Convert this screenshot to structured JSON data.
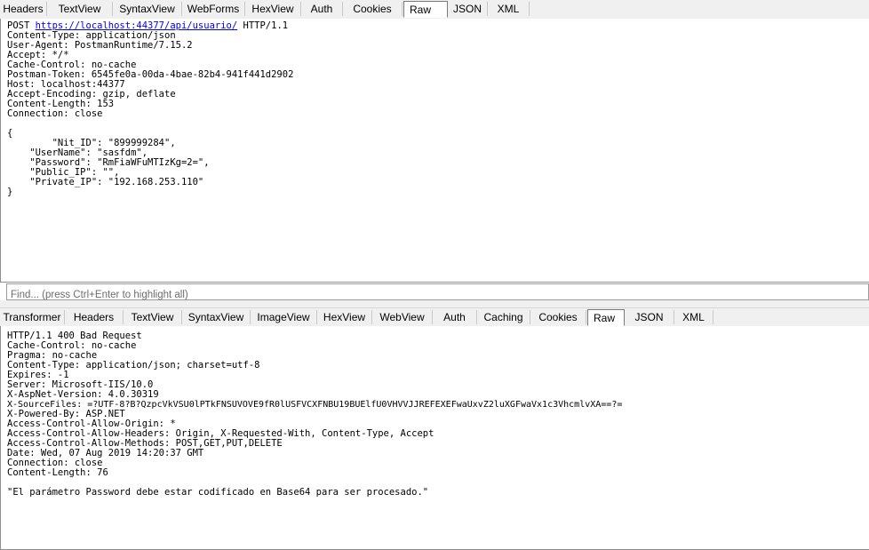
{
  "request_tabs": [
    "Headers",
    "TextView",
    "SyntaxView",
    "WebForms",
    "HexView",
    "Auth",
    "Cookies",
    "Raw",
    "JSON",
    "XML"
  ],
  "request_active_tab": "Raw",
  "request": {
    "method": "POST ",
    "url": "https://localhost:44377/api/usuario/",
    "protocol": " HTTP/1.1",
    "lines": [
      "Content-Type: application/json",
      "User-Agent: PostmanRuntime/7.15.2",
      "Accept: */*",
      "Cache-Control: no-cache",
      "Postman-Token: 6545fe0a-00da-4bae-82b4-941f441d2902",
      "Host: localhost:44377",
      "Accept-Encoding: gzip, deflate",
      "Content-Length: 153",
      "Connection: close",
      "",
      "{",
      "\t\"Nit_ID\": \"899999284\",",
      "    \"UserName\": \"sasfdm\",",
      "    \"Password\": \"RmFiaWFuMTIzKg=2=\",",
      "    \"Public_IP\": \"\",",
      "    \"Private_IP\": \"192.168.253.110\"",
      "}"
    ]
  },
  "find": {
    "placeholder": "Find... (press Ctrl+Enter to highlight all)"
  },
  "response_tabs": [
    "Transformer",
    "Headers",
    "TextView",
    "SyntaxView",
    "ImageView",
    "HexView",
    "WebView",
    "Auth",
    "Caching",
    "Cookies",
    "Raw",
    "JSON",
    "XML"
  ],
  "response_active_tab": "Raw",
  "response": {
    "lines": [
      "HTTP/1.1 400 Bad Request",
      "Cache-Control: no-cache",
      "Pragma: no-cache",
      "Content-Type: application/json; charset=utf-8",
      "Expires: -1",
      "Server: Microsoft-IIS/10.0",
      "X-AspNet-Version: 4.0.30319",
      "X-SourceFiles: =?UTF-8?B?QzpcVkVSU0lPTkFNSUVOVE9fR0lUSFVCXFNBU19BUElfU0VHVVJJREFEXEFwaUxvZ2luXGFwaVx1c3VhcmlvXA==?=",
      "X-Powered-By: ASP.NET",
      "Access-Control-Allow-Origin: *",
      "Access-Control-Allow-Headers: Origin, X-Requested-With, Content-Type, Accept",
      "Access-Control-Allow-Methods: POST,GET,PUT,DELETE",
      "Date: Wed, 07 Aug 2019 14:20:37 GMT",
      "Connection: close",
      "Content-Length: 76",
      "",
      "\"El parámetro Password debe estar codificado en Base64 para ser procesado.\""
    ]
  }
}
